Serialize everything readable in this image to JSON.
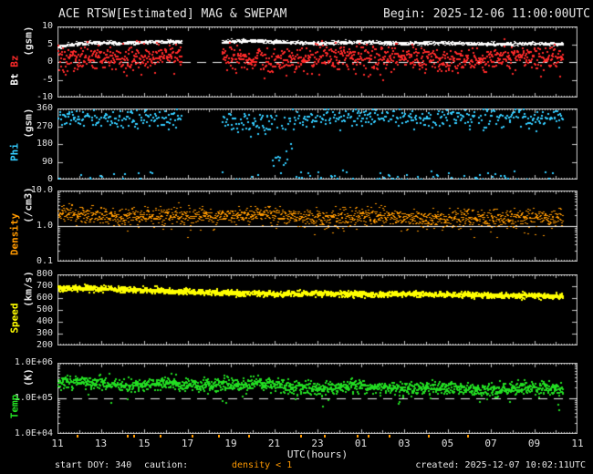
{
  "header": {
    "title": "ACE RTSW[Estimated] MAG & SWEPAM",
    "begin": "Begin: 2025-12-06 11:00:00UTC"
  },
  "footer": {
    "start_doy": "start DOY: 340",
    "caution_label": "caution:",
    "caution_value": "density < 1",
    "created": "created: 2025-12-07 10:02:11UTC"
  },
  "colors": {
    "background": "#000000",
    "frame": "#c8c8c8",
    "text": "#e8e8e8",
    "refline": "#f0f0f0",
    "bt": "#ffffff",
    "bz": "#ff2a2a",
    "phi": "#33ccff",
    "density": "#ff9900",
    "speed": "#ffff00",
    "temp": "#22dd22",
    "caution": "#ff9900"
  },
  "chart_data": {
    "type": "scatter",
    "title": "ACE RTSW[Estimated] MAG & SWEPAM",
    "begin_utc": "2025-12-06 11:00:00",
    "created_utc": "2025-12-07 10:02:11",
    "x_axis": {
      "label": "UTC(hours)",
      "tick_labels": [
        "11",
        "13",
        "15",
        "17",
        "19",
        "21",
        "23",
        "01",
        "03",
        "05",
        "07",
        "09",
        "11"
      ],
      "span_hours": 24,
      "data_end_hour": 23.3
    },
    "caution_marks_hours": [
      0.9,
      3.2,
      3.5,
      4.7,
      6.2,
      7.4,
      8.8,
      11.2,
      12.3,
      13.8,
      14.3,
      15.3,
      17.1,
      18.9
    ],
    "render_hints": {
      "noise_seed": 1337
    },
    "panels": [
      {
        "id": "bt-bz",
        "ylabel": {
          "name_parts": [
            {
              "text": "Bt",
              "color": "#ffffff"
            },
            {
              "text": " ",
              "color": "#ffffff"
            },
            {
              "text": "Bz",
              "color": "#ff2a2a"
            }
          ],
          "units": "(gsm)",
          "units_color": "#e8e8e8"
        },
        "scale": "linear",
        "ylim": [
          -10,
          10
        ],
        "yticks": [
          {
            "v": 10,
            "label": "10"
          },
          {
            "v": 5,
            "label": "5"
          },
          {
            "v": 0,
            "label": "0"
          },
          {
            "v": -5,
            "label": "-5"
          },
          {
            "v": -10,
            "label": "-10"
          }
        ],
        "refline": {
          "v": 0,
          "style": "dashed"
        },
        "gaps": [
          [
            5.7,
            7.55
          ]
        ],
        "series": [
          {
            "name": "Bt",
            "color": "#ffffff",
            "px": [
              2,
              1
            ],
            "dt": 0.012,
            "noise": 0.25,
            "hourly_values": [
              4.5,
              5.3,
              5.6,
              5.4,
              5.7,
              5.9,
              5.6,
              5.6,
              5.9,
              6.1,
              5.8,
              5.5,
              5.3,
              5.6,
              5.7,
              5.5,
              5.3,
              5.4,
              5.5,
              5.3,
              5.1,
              5.2,
              5.3,
              5.1,
              5.0
            ]
          },
          {
            "name": "Bz",
            "color": "#ff2a2a",
            "px": [
              2,
              2
            ],
            "dt": 0.02,
            "noise": 1.7,
            "tail_p": 0.08,
            "tail_mag": 4,
            "hourly_values": [
              1.2,
              1.8,
              1.6,
              1.0,
              1.8,
              2.0,
              1.6,
              1.4,
              2.2,
              1.2,
              0.3,
              1.0,
              1.4,
              1.8,
              1.6,
              1.1,
              1.4,
              1.0,
              1.1,
              0.7,
              1.4,
              1.8,
              1.4,
              1.6,
              1.4
            ]
          }
        ]
      },
      {
        "id": "phi",
        "ylabel": {
          "name_parts": [
            {
              "text": "Phi",
              "color": "#33ccff"
            }
          ],
          "units": "(gsm)",
          "units_color": "#e8e8e8"
        },
        "scale": "linear",
        "ylim": [
          0,
          360
        ],
        "yticks": [
          {
            "v": 360,
            "label": "360"
          },
          {
            "v": 270,
            "label": "270"
          },
          {
            "v": 180,
            "label": "180"
          },
          {
            "v": 90,
            "label": "90"
          },
          {
            "v": 0,
            "label": "0"
          }
        ],
        "gaps": [
          [
            5.7,
            7.55
          ]
        ],
        "series": [
          {
            "name": "Phi",
            "color": "#33ccff",
            "px": [
              2,
              2
            ],
            "dt": 0.035,
            "noise": 26,
            "wrap": 360,
            "low_frac": 0.09,
            "low_range": 45,
            "blobs": [
              {
                "t0": 9.9,
                "t1": 10.9,
                "v": 120,
                "spread": 30,
                "p": 0.45
              }
            ],
            "hourly_values": [
              325,
              320,
              318,
              312,
              318,
              308,
              312,
              318,
              305,
              285,
              300,
              310,
              315,
              322,
              326,
              330,
              322,
              316,
              320,
              326,
              330,
              326,
              322,
              318,
              320
            ]
          }
        ]
      },
      {
        "id": "density",
        "ylabel": {
          "name_parts": [
            {
              "text": "Density",
              "color": "#ff9900"
            }
          ],
          "units": "(/cm3)",
          "units_color": "#e8e8e8"
        },
        "scale": "log",
        "ylim": [
          0.1,
          10
        ],
        "yticks": [
          {
            "v": 10,
            "label": "10.0"
          },
          {
            "v": 1,
            "label": "1.0"
          },
          {
            "v": 0.1,
            "label": "0.1"
          }
        ],
        "refline": {
          "v": 1,
          "style": "solid"
        },
        "series": [
          {
            "name": "Density",
            "color": "#ff9900",
            "px": [
              2,
              1
            ],
            "dt": 0.015,
            "noise": 0.12,
            "tail_p": 0.05,
            "tail_mag": 0.5,
            "hourly_values": [
              2.6,
              2.1,
              2.0,
              1.9,
              2.0,
              2.2,
              2.0,
              1.9,
              2.1,
              2.3,
              2.0,
              1.8,
              1.7,
              1.9,
              2.0,
              1.9,
              1.7,
              1.6,
              1.7,
              1.8,
              1.7,
              1.6,
              1.8,
              2.0,
              2.0
            ]
          }
        ]
      },
      {
        "id": "speed",
        "ylabel": {
          "name_parts": [
            {
              "text": "Speed",
              "color": "#ffff00"
            }
          ],
          "units": "(km/s)",
          "units_color": "#e8e8e8"
        },
        "scale": "linear",
        "ylim": [
          200,
          800
        ],
        "yticks": [
          {
            "v": 800,
            "label": "800"
          },
          {
            "v": 700,
            "label": "700"
          },
          {
            "v": 600,
            "label": "600"
          },
          {
            "v": 500,
            "label": "500"
          },
          {
            "v": 400,
            "label": "400"
          },
          {
            "v": 300,
            "label": "300"
          },
          {
            "v": 200,
            "label": "200"
          }
        ],
        "series": [
          {
            "name": "Speed",
            "color": "#ffff00",
            "px": [
              2,
              2
            ],
            "dt": 0.012,
            "noise": 12,
            "hourly_values": [
              685,
              692,
              686,
              678,
              672,
              668,
              662,
              656,
              650,
              646,
              641,
              645,
              648,
              644,
              640,
              638,
              641,
              639,
              636,
              633,
              630,
              628,
              626,
              622,
              620
            ]
          }
        ]
      },
      {
        "id": "temp",
        "ylabel": {
          "name_parts": [
            {
              "text": "Temp",
              "color": "#22dd22"
            }
          ],
          "units": "(K)",
          "units_color": "#e8e8e8"
        },
        "scale": "log",
        "ylim": [
          10000,
          1000000
        ],
        "yticks": [
          {
            "v": 1000000,
            "label": "1.0E+06"
          },
          {
            "v": 100000,
            "label": "1.0E+05"
          },
          {
            "v": 10000,
            "label": "1.0E+04"
          }
        ],
        "refline": {
          "v": 100000,
          "style": "dashed"
        },
        "series": [
          {
            "name": "Temp",
            "color": "#22dd22",
            "px": [
              2,
              2
            ],
            "dt": 0.015,
            "noise": 0.09,
            "tail_p": 0.02,
            "tail_mag": 0.5,
            "hourly_values": [
              280000,
              320000,
              280000,
              250000,
              260000,
              280000,
              250000,
              240000,
              260000,
              280000,
              250000,
              220000,
              200000,
              220000,
              240000,
              210000,
              200000,
              210000,
              220000,
              200000,
              190000,
              200000,
              210000,
              190000,
              170000
            ]
          }
        ]
      }
    ]
  }
}
